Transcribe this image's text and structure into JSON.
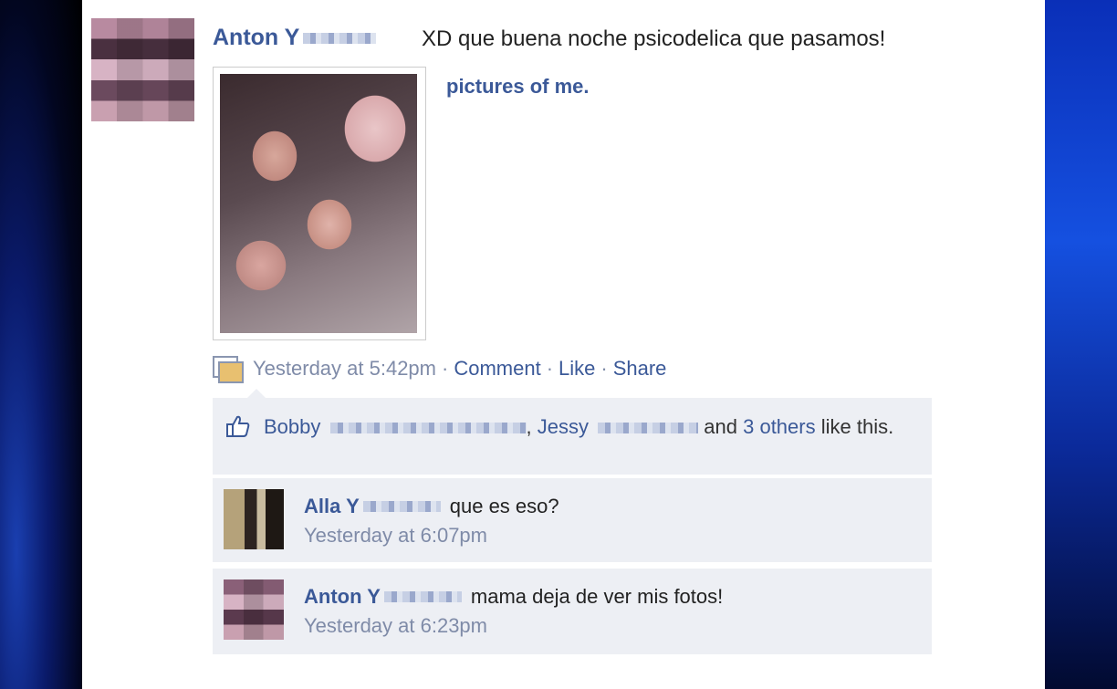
{
  "post": {
    "author": "Anton Y",
    "text": "XD que buena noche psicodelica que pasamos!",
    "photo_caption": "pictures of me.",
    "timestamp": "Yesterday at 5:42pm",
    "actions": {
      "comment": "Comment",
      "like": "Like",
      "share": "Share",
      "separator": "·"
    }
  },
  "likes": {
    "person1": "Bobby",
    "comma": ",",
    "person2": "Jessy",
    "suffix": "and",
    "others": "3 others",
    "like_this": "like this."
  },
  "comments": [
    {
      "author": "Alla Y",
      "text": "que es eso?",
      "timestamp": "Yesterday at 6:07pm"
    },
    {
      "author": "Anton Y",
      "text": "mama deja de ver mis fotos!",
      "timestamp": "Yesterday at 6:23pm"
    }
  ],
  "colors": {
    "link": "#3b5998",
    "meta": "#7f8ba8",
    "comment_bg": "#edeff4"
  },
  "icons": [
    "photo-icon",
    "thumbs-up-icon"
  ]
}
